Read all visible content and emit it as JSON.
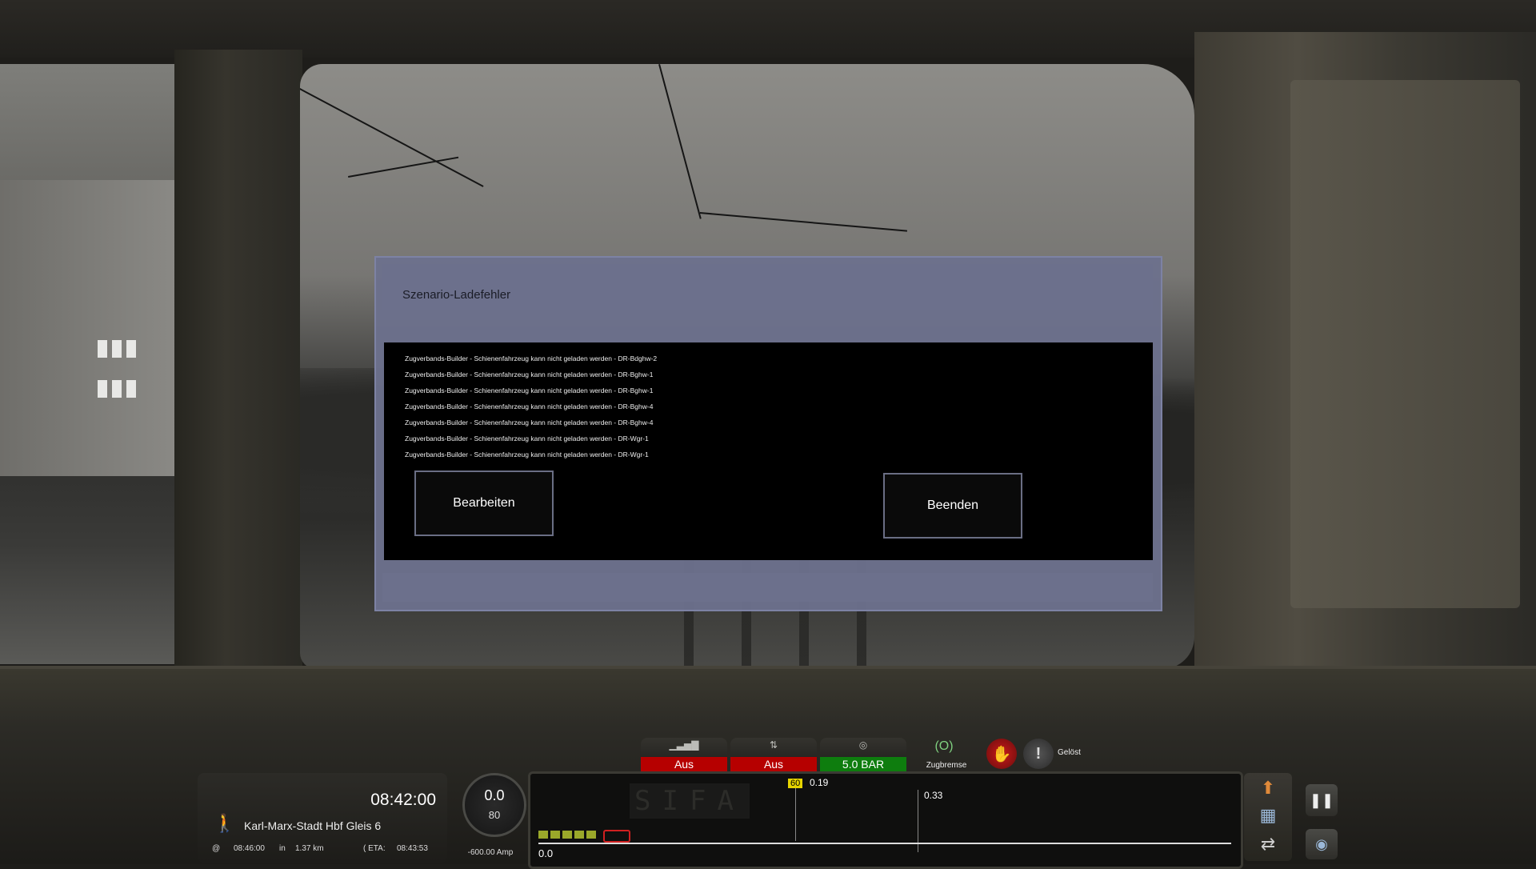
{
  "dialog": {
    "title": "Szenario-Ladefehler",
    "messages": [
      "Zugverbands-Builder - Schienenfahrzeug kann nicht geladen werden - DR-Bdghw-2",
      "Zugverbands-Builder - Schienenfahrzeug kann nicht geladen werden - DR-Bghw-1",
      "Zugverbands-Builder - Schienenfahrzeug kann nicht geladen werden - DR-Bghw-1",
      "Zugverbands-Builder - Schienenfahrzeug kann nicht geladen werden - DR-Bghw-4",
      "Zugverbands-Builder - Schienenfahrzeug kann nicht geladen werden - DR-Bghw-4",
      "Zugverbands-Builder - Schienenfahrzeug kann nicht geladen werden - DR-Wgr-1",
      "Zugverbands-Builder - Schienenfahrzeug kann nicht geladen werden - DR-Wgr-1"
    ],
    "edit_label": "Bearbeiten",
    "quit_label": "Beenden"
  },
  "hud": {
    "gauges": [
      {
        "icon": "signal-bars-icon",
        "label": "Aus",
        "color": "#b60000"
      },
      {
        "icon": "updown-arrows-icon",
        "label": "Aus",
        "color": "#b60000"
      },
      {
        "icon": "pressure-icon",
        "label": "5.0 BAR",
        "color": "#0e7d0e"
      }
    ],
    "train_brake_label": "Zugbremse",
    "released_label": "Gelöst",
    "clock": "08:42:00",
    "station": "Karl-Marx-Stadt Hbf Gleis 6",
    "at_time": "08:46:00",
    "in_label": "in",
    "distance": "1.37 km",
    "eta_label": "( ETA:",
    "eta_time": "08:43:53",
    "speed": "0.0",
    "speed_limit": "80",
    "amperage": "-600.00 Amp",
    "sifa": "SIFA",
    "limit_value": "60",
    "dist_1": "0.19",
    "dist_2": "0.33",
    "monitor_zero": "0.0",
    "at_symbol": "@"
  }
}
